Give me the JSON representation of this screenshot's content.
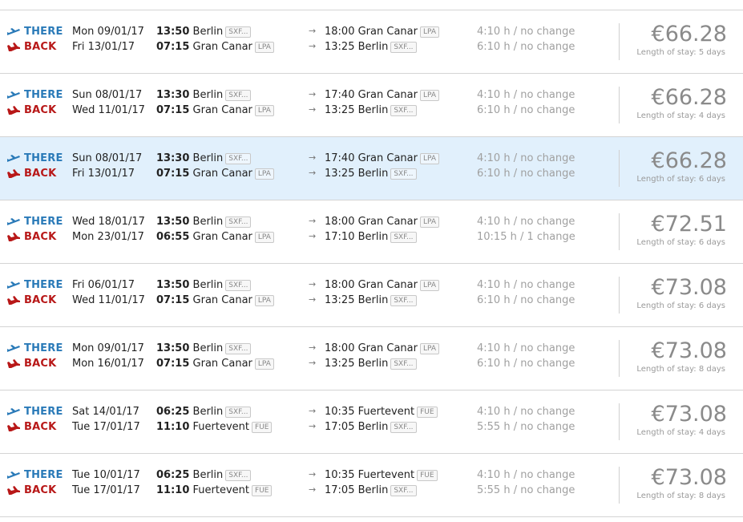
{
  "labels": {
    "there": "THERE",
    "back": "BACK",
    "arrow": "→"
  },
  "colors": {
    "there_blue": "#2a7ab8",
    "back_red": "#b81818",
    "selected_row": "#e1f0fc"
  },
  "icons": {
    "there": "plane-takeoff-icon",
    "back": "plane-landing-icon"
  },
  "selected_index": 2,
  "rows": [
    {
      "there": {
        "date": "Mon 09/01/17",
        "dep_time": "13:50",
        "dep_city": "Berlin",
        "dep_code": "SXF...",
        "arr_time": "18:00",
        "arr_city": "Gran Canar",
        "arr_code": "LPA",
        "duration": "4:10 h / no change"
      },
      "back": {
        "date": "Fri 13/01/17",
        "dep_time": "07:15",
        "dep_city": "Gran Canar",
        "dep_code": "LPA",
        "arr_time": "13:25",
        "arr_city": "Berlin",
        "arr_code": "SXF...",
        "duration": "6:10 h / no change"
      },
      "price": "€66.28",
      "stay": "Length of stay: 5 days"
    },
    {
      "there": {
        "date": "Sun 08/01/17",
        "dep_time": "13:30",
        "dep_city": "Berlin",
        "dep_code": "SXF...",
        "arr_time": "17:40",
        "arr_city": "Gran Canar",
        "arr_code": "LPA",
        "duration": "4:10 h / no change"
      },
      "back": {
        "date": "Wed 11/01/17",
        "dep_time": "07:15",
        "dep_city": "Gran Canar",
        "dep_code": "LPA",
        "arr_time": "13:25",
        "arr_city": "Berlin",
        "arr_code": "SXF...",
        "duration": "6:10 h / no change"
      },
      "price": "€66.28",
      "stay": "Length of stay: 4 days"
    },
    {
      "there": {
        "date": "Sun 08/01/17",
        "dep_time": "13:30",
        "dep_city": "Berlin",
        "dep_code": "SXF...",
        "arr_time": "17:40",
        "arr_city": "Gran Canar",
        "arr_code": "LPA",
        "duration": "4:10 h / no change"
      },
      "back": {
        "date": "Fri 13/01/17",
        "dep_time": "07:15",
        "dep_city": "Gran Canar",
        "dep_code": "LPA",
        "arr_time": "13:25",
        "arr_city": "Berlin",
        "arr_code": "SXF...",
        "duration": "6:10 h / no change"
      },
      "price": "€66.28",
      "stay": "Length of stay: 6 days"
    },
    {
      "there": {
        "date": "Wed 18/01/17",
        "dep_time": "13:50",
        "dep_city": "Berlin",
        "dep_code": "SXF...",
        "arr_time": "18:00",
        "arr_city": "Gran Canar",
        "arr_code": "LPA",
        "duration": "4:10 h / no change"
      },
      "back": {
        "date": "Mon 23/01/17",
        "dep_time": "06:55",
        "dep_city": "Gran Canar",
        "dep_code": "LPA",
        "arr_time": "17:10",
        "arr_city": "Berlin",
        "arr_code": "SXF...",
        "duration": "10:15 h / 1 change"
      },
      "price": "€72.51",
      "stay": "Length of stay: 6 days"
    },
    {
      "there": {
        "date": "Fri 06/01/17",
        "dep_time": "13:50",
        "dep_city": "Berlin",
        "dep_code": "SXF...",
        "arr_time": "18:00",
        "arr_city": "Gran Canar",
        "arr_code": "LPA",
        "duration": "4:10 h / no change"
      },
      "back": {
        "date": "Wed 11/01/17",
        "dep_time": "07:15",
        "dep_city": "Gran Canar",
        "dep_code": "LPA",
        "arr_time": "13:25",
        "arr_city": "Berlin",
        "arr_code": "SXF...",
        "duration": "6:10 h / no change"
      },
      "price": "€73.08",
      "stay": "Length of stay: 6 days"
    },
    {
      "there": {
        "date": "Mon 09/01/17",
        "dep_time": "13:50",
        "dep_city": "Berlin",
        "dep_code": "SXF...",
        "arr_time": "18:00",
        "arr_city": "Gran Canar",
        "arr_code": "LPA",
        "duration": "4:10 h / no change"
      },
      "back": {
        "date": "Mon 16/01/17",
        "dep_time": "07:15",
        "dep_city": "Gran Canar",
        "dep_code": "LPA",
        "arr_time": "13:25",
        "arr_city": "Berlin",
        "arr_code": "SXF...",
        "duration": "6:10 h / no change"
      },
      "price": "€73.08",
      "stay": "Length of stay: 8 days"
    },
    {
      "there": {
        "date": "Sat 14/01/17",
        "dep_time": "06:25",
        "dep_city": "Berlin",
        "dep_code": "SXF...",
        "arr_time": "10:35",
        "arr_city": "Fuertevent",
        "arr_code": "FUE",
        "duration": "4:10 h / no change"
      },
      "back": {
        "date": "Tue 17/01/17",
        "dep_time": "11:10",
        "dep_city": "Fuertevent",
        "dep_code": "FUE",
        "arr_time": "17:05",
        "arr_city": "Berlin",
        "arr_code": "SXF...",
        "duration": "5:55 h / no change"
      },
      "price": "€73.08",
      "stay": "Length of stay: 4 days"
    },
    {
      "there": {
        "date": "Tue 10/01/17",
        "dep_time": "06:25",
        "dep_city": "Berlin",
        "dep_code": "SXF...",
        "arr_time": "10:35",
        "arr_city": "Fuertevent",
        "arr_code": "FUE",
        "duration": "4:10 h / no change"
      },
      "back": {
        "date": "Tue 17/01/17",
        "dep_time": "11:10",
        "dep_city": "Fuertevent",
        "dep_code": "FUE",
        "arr_time": "17:05",
        "arr_city": "Berlin",
        "arr_code": "SXF...",
        "duration": "5:55 h / no change"
      },
      "price": "€73.08",
      "stay": "Length of stay: 8 days"
    }
  ]
}
